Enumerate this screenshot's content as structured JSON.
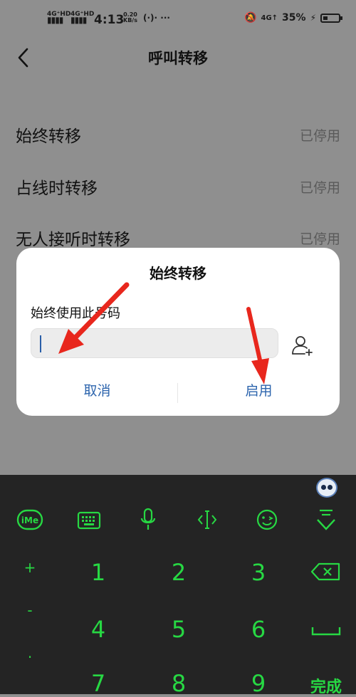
{
  "status_bar": {
    "sig1": "4G⁺HD",
    "sig2": "4G⁺HD",
    "time": "4:13",
    "speed_val": "0.20",
    "speed_unit": "KB/s",
    "misc": "(·)· ···",
    "net": "4G↑",
    "battery_pct": "35%"
  },
  "header": {
    "title": "呼叫转移"
  },
  "settings": [
    {
      "label": "始终转移",
      "value": "已停用"
    },
    {
      "label": "占线时转移",
      "value": "已停用"
    },
    {
      "label": "无人接听时转移",
      "value": "已停用"
    }
  ],
  "dialog": {
    "title": "始终转移",
    "subtitle": "始终使用此号码",
    "input_value": "",
    "cancel_label": "取消",
    "enable_label": "启用"
  },
  "keyboard": {
    "numbers": [
      "1",
      "2",
      "3",
      "4",
      "5",
      "6",
      "7",
      "8",
      "9"
    ],
    "side_symbols": [
      "+",
      "-",
      "."
    ],
    "done_label": "完成",
    "icons": [
      "ime-logo-icon",
      "keyboard-icon",
      "microphone-icon",
      "cursor-move-icon",
      "emoji-icon",
      "collapse-keyboard-icon"
    ]
  },
  "colors": {
    "accent_green": "#27d843",
    "link_blue": "#2c64ad",
    "arrow_red": "#e8271d"
  }
}
